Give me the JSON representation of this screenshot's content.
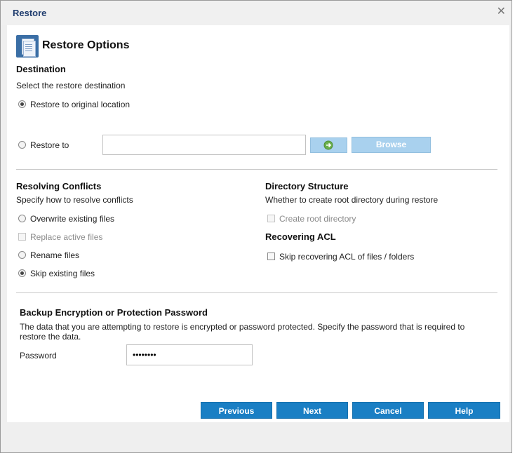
{
  "window": {
    "title": "Restore",
    "close_glyph": "✕"
  },
  "header": {
    "title": "Restore Options",
    "icon": "document-stack-icon"
  },
  "destination": {
    "heading": "Destination",
    "subtitle": "Select the restore destination",
    "option_original": "Restore to original location",
    "option_restore_to": "Restore to",
    "path_value": "",
    "browse_label": "Browse",
    "selected": "original"
  },
  "conflicts": {
    "heading": "Resolving Conflicts",
    "subtitle": "Specify how to resolve conflicts",
    "overwrite": "Overwrite existing files",
    "replace_active": "Replace active files",
    "rename": "Rename files",
    "skip": "Skip existing files",
    "selected": "skip"
  },
  "directory": {
    "heading": "Directory Structure",
    "subtitle": "Whether to create root directory during restore",
    "create_root": "Create root directory"
  },
  "acl": {
    "heading": "Recovering ACL",
    "skip_acl": "Skip recovering ACL of files / folders"
  },
  "encryption": {
    "heading": "Backup Encryption or Protection Password",
    "description_line1": "The data that you are attempting to restore is encrypted or password protected. Specify the password that is required to",
    "description_line2": "restore the data.",
    "password_label": "Password",
    "password_value": "••••••••"
  },
  "footer": {
    "previous": "Previous",
    "next": "Next",
    "cancel": "Cancel",
    "help": "Help"
  },
  "colors": {
    "primary_button": "#1a7fc4",
    "disabled_button": "#a9d1ee",
    "title_text": "#1f3c6e"
  }
}
